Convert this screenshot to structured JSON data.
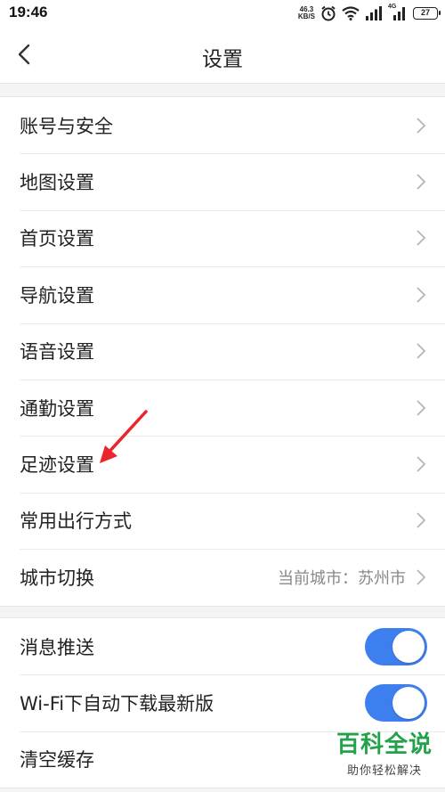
{
  "status_bar": {
    "time": "19:46",
    "net_speed_value": "46.3",
    "net_speed_unit": "KB/S",
    "network_type": "4G",
    "battery": "27"
  },
  "nav": {
    "title": "设置",
    "back_icon": "chevron-left-icon"
  },
  "settings": {
    "main_items": [
      {
        "label": "账号与安全"
      },
      {
        "label": "地图设置"
      },
      {
        "label": "首页设置"
      },
      {
        "label": "导航设置"
      },
      {
        "label": "语音设置"
      },
      {
        "label": "通勤设置"
      },
      {
        "label": "足迹设置"
      },
      {
        "label": "常用出行方式"
      },
      {
        "label": "城市切换",
        "value": "当前城市：苏州市"
      }
    ],
    "secondary_items": [
      {
        "label": "消息推送",
        "toggle": true
      },
      {
        "label": "Wi-Fi下自动下载最新版",
        "toggle": true
      },
      {
        "label": "清空缓存"
      }
    ]
  },
  "watermark": {
    "title": "百科全说",
    "subtitle": "助你轻松解决"
  },
  "colors": {
    "toggle_on": "#3e7ff0",
    "annotation_arrow": "#e8262b",
    "watermark_green": "#22a24a"
  }
}
